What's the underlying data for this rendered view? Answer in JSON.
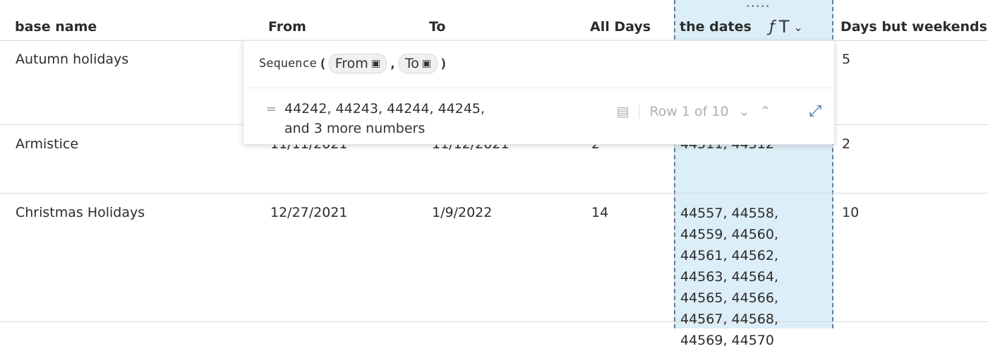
{
  "columns": [
    "base name",
    "From",
    "To",
    "All Days",
    "the dates",
    "Days but weekends"
  ],
  "header_icons": {
    "formula": "ƒ",
    "type": "T",
    "menu": "⌄"
  },
  "rows": [
    {
      "name": "Autumn holidays",
      "from": "",
      "to": "",
      "all_days": "",
      "dates": "",
      "weekdays": "5"
    },
    {
      "name": "Armistice",
      "from": "11/11/2021",
      "to": "11/12/2021",
      "all_days": "2",
      "dates": "44511, 44512",
      "weekdays": "2"
    },
    {
      "name": "Christmas Holidays",
      "from": "12/27/2021",
      "to": "1/9/2022",
      "all_days": "14",
      "dates": "44557, 44558, 44559, 44560, 44561, 44562, 44563, 44564, 44565, 44566, 44567, 44568, 44569, 44570",
      "weekdays": "10"
    }
  ],
  "formula_popup": {
    "function": "Sequence",
    "open_paren": "(",
    "arg1": "From",
    "comma": ",",
    "arg2": "To",
    "close_paren": ")",
    "equals": "=",
    "result_line1": "44242, 44243, 44244, 44245,",
    "result_line2": "and 3 more numbers",
    "row_indicator": "Row 1 of 10"
  },
  "icons": [
    "calendar-icon",
    "drag-handle-icon",
    "formula-icon",
    "text-type-icon",
    "chevron-down-icon",
    "list-view-icon",
    "chevron-up-icon",
    "expand-icon"
  ],
  "colors": {
    "selected_column_bg": "#dceef7",
    "selected_border": "#6a7e93",
    "expand_accent": "#2e6da4"
  }
}
